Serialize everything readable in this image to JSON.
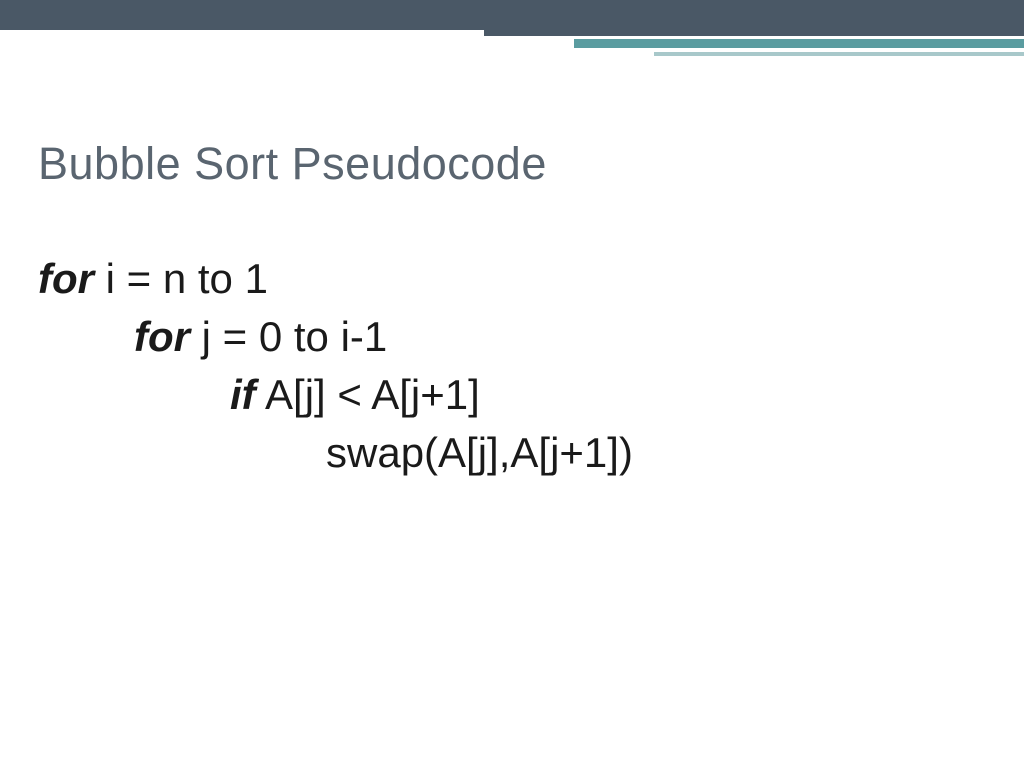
{
  "slide": {
    "title": "Bubble Sort Pseudocode",
    "code": {
      "line1": {
        "kw": "for",
        "rest": " i = n to 1"
      },
      "line2": {
        "kw": "for",
        "rest": " j = 0 to i-1"
      },
      "line3": {
        "kw": "if",
        "rest": " A[j] < A[j+1]"
      },
      "line4": {
        "rest": "swap(A[j],A[j+1])"
      }
    }
  }
}
